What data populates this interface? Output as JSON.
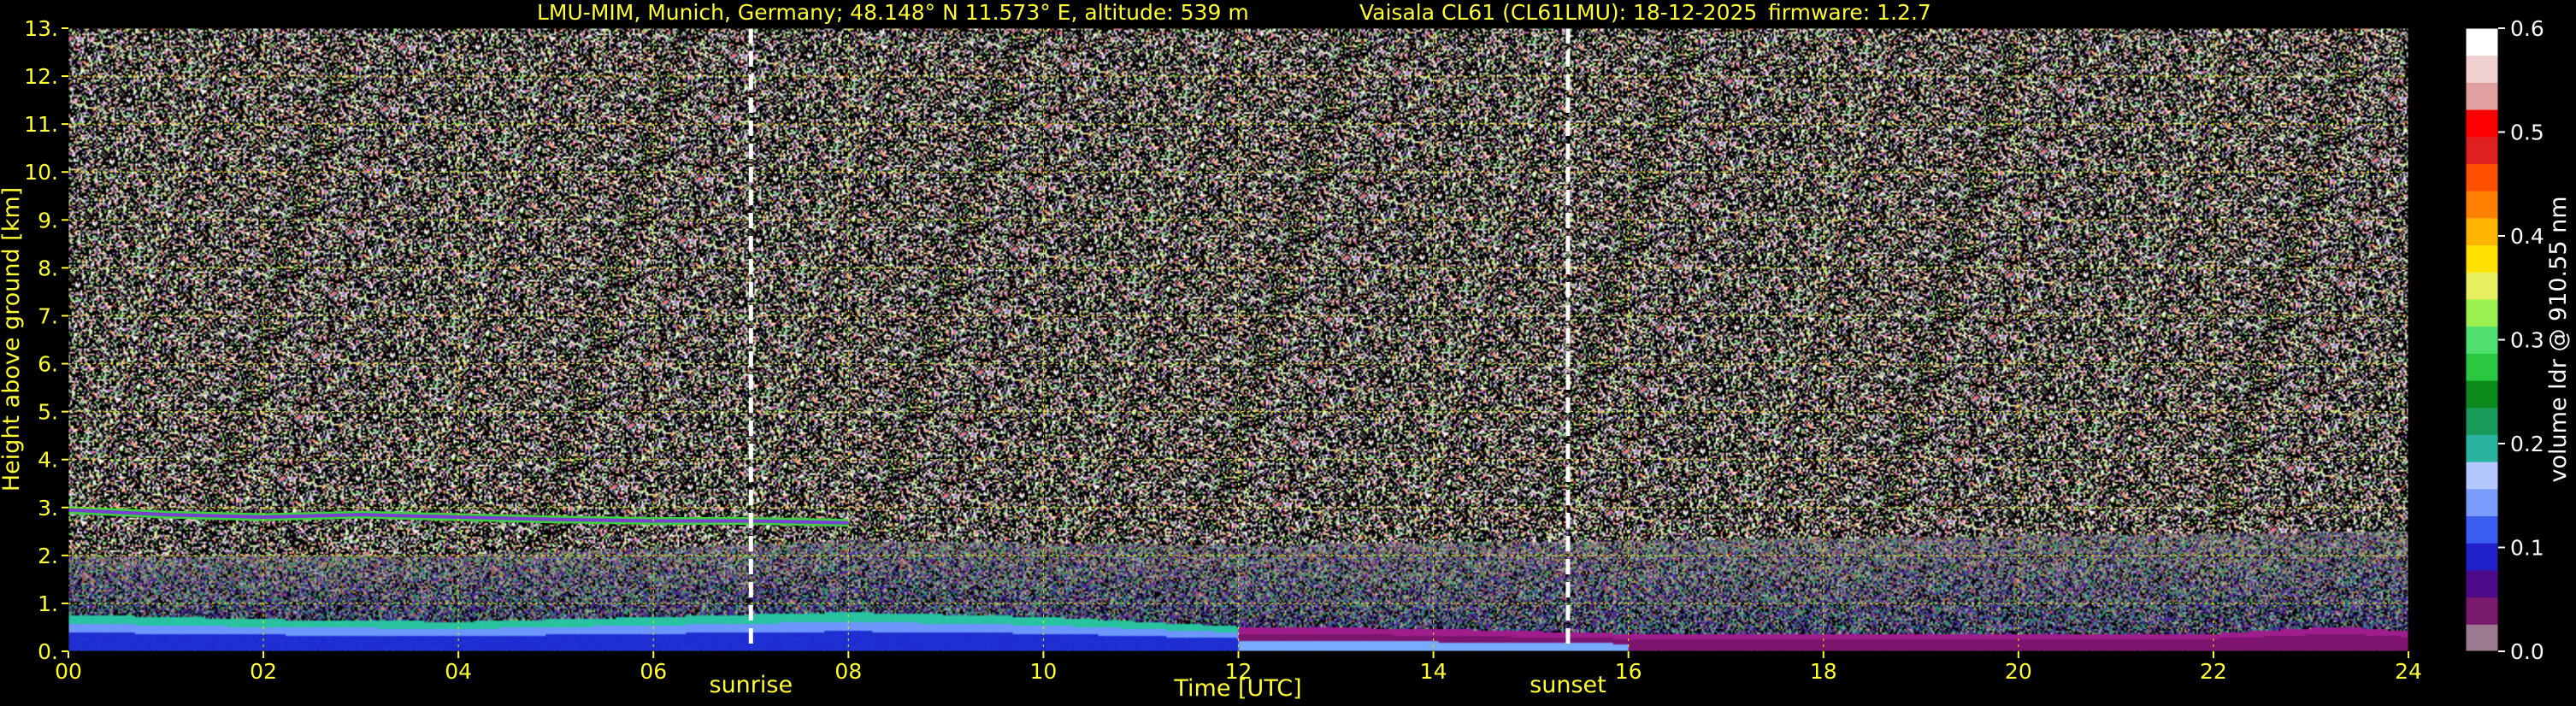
{
  "header": {
    "station": "LMU-MIM, Munich, Germany; 48.148° N 11.573° E, altitude: 539 m",
    "instrument": "Vaisala CL61 (CL61LMU): 18-12-2025",
    "firmware": "firmware: 1.2.7"
  },
  "colors": {
    "background": "#000000",
    "text": "#ffff33",
    "grid": "#e6e600",
    "marker": "#ffffff"
  },
  "chart_data": {
    "type": "heatmap",
    "xlabel": "Time [UTC]",
    "ylabel": "Height above ground [km]",
    "xlim": [
      0,
      24
    ],
    "ylim": [
      0,
      13
    ],
    "x_ticks": [
      0,
      2,
      4,
      6,
      8,
      10,
      12,
      14,
      16,
      18,
      20,
      22,
      24
    ],
    "x_tick_labels": [
      "00",
      "02",
      "04",
      "06",
      "08",
      "10",
      "12",
      "14",
      "16",
      "18",
      "20",
      "22",
      "24"
    ],
    "y_ticks": [
      0,
      1,
      2,
      3,
      4,
      5,
      6,
      7,
      8,
      9,
      10,
      11,
      12,
      13
    ],
    "y_tick_labels": [
      "0.",
      "1.",
      "2.",
      "3.",
      "4.",
      "5.",
      "6.",
      "7.",
      "8.",
      "9.",
      "10.",
      "11.",
      "12.",
      "13."
    ],
    "grid": true,
    "annotations": [
      {
        "label": "sunrise",
        "time": 7.0
      },
      {
        "label": "sunset",
        "time": 15.38
      }
    ],
    "features": {
      "cloud_layer": {
        "x": [
          0,
          1,
          2,
          3,
          4,
          5,
          6,
          7,
          8
        ],
        "y": [
          2.95,
          2.85,
          2.8,
          2.85,
          2.8,
          2.75,
          2.72,
          2.72,
          2.68
        ]
      },
      "boundary_layer_top": {
        "x": [
          0,
          2,
          4,
          6,
          8,
          10,
          12,
          14,
          16,
          18,
          20,
          22,
          23.3,
          24
        ],
        "y": [
          0.75,
          0.65,
          0.6,
          0.7,
          0.8,
          0.7,
          0.5,
          0.45,
          0.35,
          0.35,
          0.35,
          0.35,
          0.5,
          0.4
        ]
      },
      "noise_floor_top": {
        "x": [
          0,
          4,
          8,
          12,
          16,
          20,
          24
        ],
        "y": [
          2.0,
          2.0,
          2.3,
          2.2,
          2.3,
          2.4,
          2.5
        ]
      }
    },
    "colorbar": {
      "label": "volume ldr @ 910.55 nm",
      "min": 0.0,
      "max": 0.6,
      "ticks": [
        0.0,
        0.1,
        0.2,
        0.3,
        0.4,
        0.5,
        0.6
      ],
      "tick_labels": [
        "0.0",
        "0.1",
        "0.2",
        "0.3",
        "0.4",
        "0.5",
        "0.6"
      ],
      "colors": [
        "#9c7a8f",
        "#7a1a6e",
        "#4b0a8a",
        "#2020c8",
        "#3a5cf0",
        "#7a9cff",
        "#b4c8ff",
        "#2ab4a0",
        "#1a9a5a",
        "#0a8a1a",
        "#2ac840",
        "#50e070",
        "#9cf050",
        "#e8f060",
        "#ffe000",
        "#ffb400",
        "#ff8000",
        "#ff5000",
        "#e02020",
        "#ff0000",
        "#e0a0a0",
        "#f0d0d0",
        "#ffffff"
      ]
    }
  }
}
